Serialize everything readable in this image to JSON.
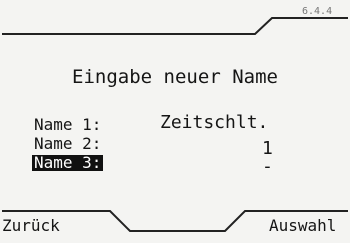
{
  "header": {
    "version": "6.4.4"
  },
  "dialog": {
    "title": "Eingabe neuer Name",
    "fields": [
      {
        "label": "Name 1:",
        "value": "Zeitschlt."
      },
      {
        "label": "Name 2:",
        "value": "1"
      },
      {
        "label": "Name 3:",
        "value": "-"
      }
    ],
    "selected_field_index": 2
  },
  "softkeys": {
    "left": "Zurück",
    "right": "Auswahl"
  }
}
